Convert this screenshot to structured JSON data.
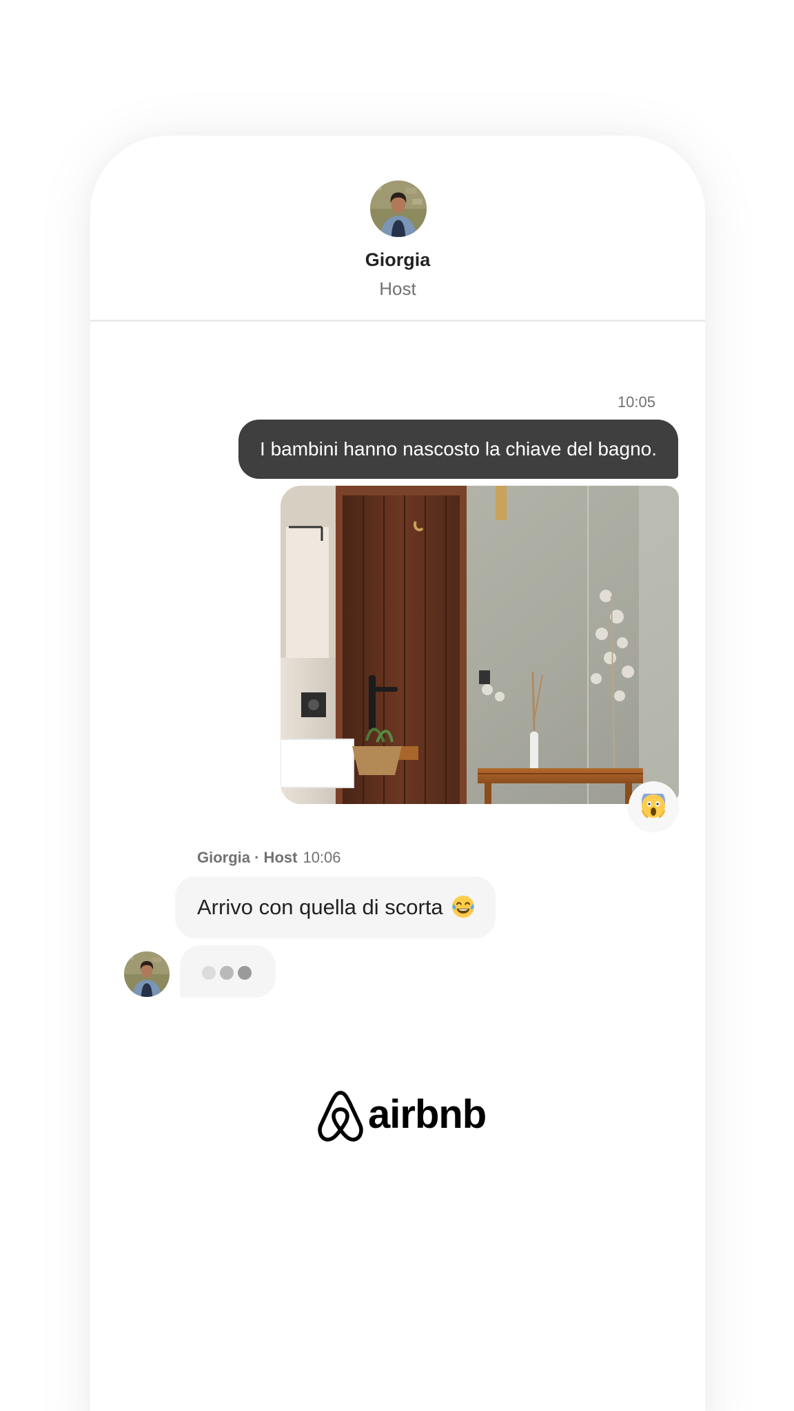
{
  "conversation": {
    "host_name": "Giorgia",
    "host_role": "Host"
  },
  "messages": {
    "outgoing": {
      "time": "10:05",
      "text": "I bambini hanno nascosto la chiave del bagno.",
      "photo_icon": "bathroom-door-photo",
      "reaction_icon": "screaming-face-emoji"
    },
    "incoming": {
      "sender": "Giorgia · Host",
      "time": "10:06",
      "text": "Arrivo con quella di scorta",
      "emoji_icon": "laughing-tears-emoji"
    },
    "typing_icon": "typing-dots"
  },
  "brand": {
    "wordmark": "airbnb",
    "logo_icon": "airbnb-belo-icon",
    "color": "#000000"
  },
  "colors": {
    "outgoing_bubble": "#3f3f3f",
    "incoming_bubble": "#f5f5f5",
    "secondary_text": "#717171"
  }
}
